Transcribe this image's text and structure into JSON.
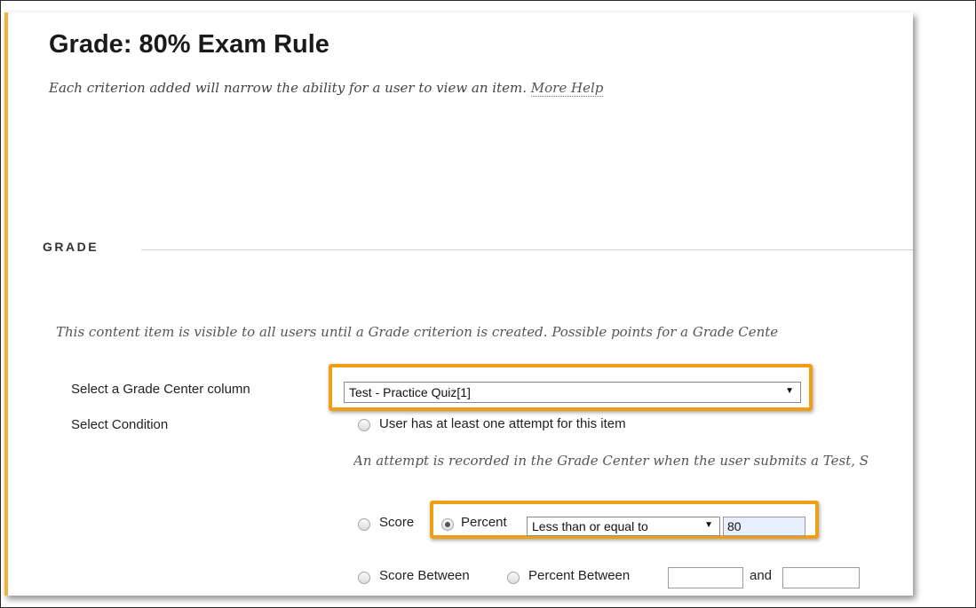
{
  "page": {
    "title": "Grade: 80% Exam Rule",
    "intro": "Each criterion added will narrow the ability for a user to view an item.",
    "more_help": "More Help"
  },
  "grade_section": {
    "title": "GRADE",
    "note": "This content item is visible to all users until a Grade criterion is created. Possible points for a Grade Cente"
  },
  "column_select": {
    "label": "Select a Grade Center column",
    "value": "Test - Practice Quiz[1]"
  },
  "condition": {
    "label": "Select Condition",
    "attempt_option": "User has at least one attempt for this item",
    "attempt_note": "An attempt is recorded in the Grade Center when the user submits a Test, S",
    "score_option": "Score",
    "percent_option": "Percent",
    "percent_operator": "Less than or equal to",
    "percent_value": "80",
    "score_between_option": "Score Between",
    "percent_between_option": "Percent Between",
    "and_label": "and",
    "selected": "percent"
  },
  "colors": {
    "highlight": "#f09e16",
    "left_stripe": "#f2b13b"
  }
}
